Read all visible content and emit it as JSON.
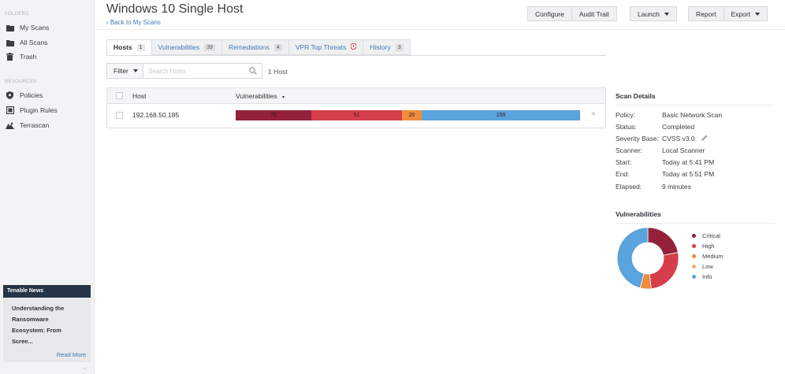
{
  "sidebar": {
    "folders_title": "FOLDERS",
    "folders": [
      {
        "label": "My Scans",
        "icon": "folder-icon"
      },
      {
        "label": "All Scans",
        "icon": "folder-icon"
      },
      {
        "label": "Trash",
        "icon": "trash-icon"
      }
    ],
    "resources_title": "RESOURCES",
    "resources": [
      {
        "label": "Policies",
        "icon": "shield-icon"
      },
      {
        "label": "Plugin Rules",
        "icon": "plugin-rules-icon"
      },
      {
        "label": "Terrascan",
        "icon": "terrascan-icon"
      }
    ],
    "news": {
      "title": "Tenable News",
      "headline_lines": [
        "Understanding the",
        "Ransomware",
        "Ecosystem: From",
        "Scree..."
      ],
      "read_more": "Read More"
    },
    "collapse_glyph": "«"
  },
  "header": {
    "title": "Windows 10 Single Host",
    "back_link": "‹ Back to My Scans",
    "configure": "Configure",
    "audit_trail": "Audit Trail",
    "launch": "Launch",
    "report": "Report",
    "export": "Export"
  },
  "tabs": [
    {
      "label": "Hosts",
      "count": "1",
      "active": true
    },
    {
      "label": "Vulnerabilities",
      "count": "39"
    },
    {
      "label": "Remediations",
      "count": "4"
    },
    {
      "label": "VPR Top Threats",
      "icon": "vpr-shield-icon"
    },
    {
      "label": "History",
      "count": "3"
    }
  ],
  "filter": {
    "label": "Filter",
    "search_placeholder": "Search Hosts",
    "host_count": "1 Host"
  },
  "table": {
    "col_host": "Host",
    "col_vulns": "Vulnerabilities",
    "sort_glyph": "▾",
    "rows": [
      {
        "host": "192.168.50.185",
        "severity": [
          {
            "label": "76",
            "value": 76,
            "color": "#93213a"
          },
          {
            "label": "91",
            "value": 91,
            "color": "#d63e4b"
          },
          {
            "label": "20",
            "value": 20,
            "color": "#ef8c3b"
          },
          {
            "label": "159",
            "value": 159,
            "color": "#5aa3dc"
          }
        ]
      }
    ]
  },
  "scan_details": {
    "title": "Scan Details",
    "policy_label": "Policy:",
    "policy": "Basic Network Scan",
    "status_label": "Status:",
    "status": "Completed",
    "severity_base_label": "Severity Base:",
    "severity_base": "CVSS v3.0",
    "scanner_label": "Scanner:",
    "scanner": "Local Scanner",
    "start_label": "Start:",
    "start": "Today at 5:41 PM",
    "end_label": "End:",
    "end": "Today at 5:51 PM",
    "elapsed_label": "Elapsed:",
    "elapsed": "9 minutes"
  },
  "vuln_chart": {
    "title": "Vulnerabilities",
    "legend": [
      {
        "label": "Critical",
        "color": "#93213a"
      },
      {
        "label": "High",
        "color": "#d63e4b"
      },
      {
        "label": "Medium",
        "color": "#ef8c3b"
      },
      {
        "label": "Low",
        "color": "#f3b35f"
      },
      {
        "label": "Info",
        "color": "#5aa3dc"
      }
    ],
    "values": [
      76,
      91,
      20,
      0,
      159
    ]
  }
}
